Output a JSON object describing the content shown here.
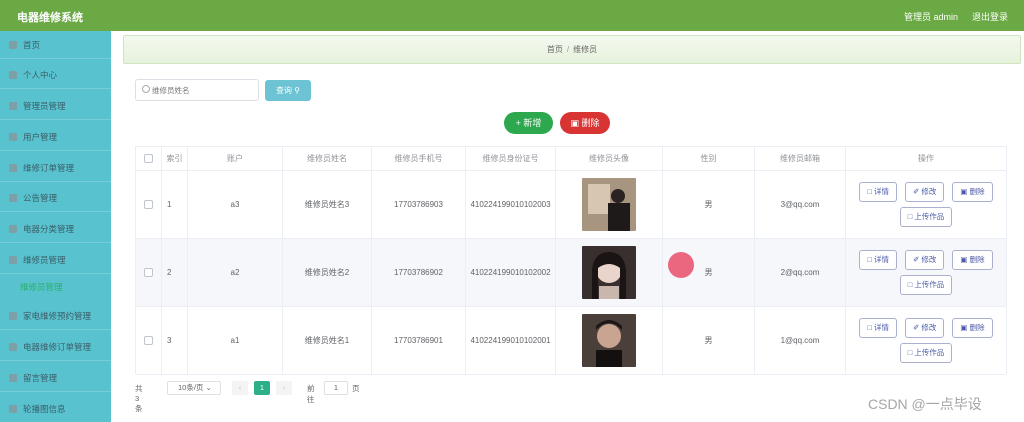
{
  "header": {
    "app_title": "电器维修系统",
    "admin_label": "管理员 admin",
    "logout_label": "退出登录",
    "bg_color": "#6aa944"
  },
  "sidebar": {
    "items": [
      {
        "label": "首页",
        "icon": "home-icon"
      },
      {
        "label": "个人中心",
        "icon": "user-icon"
      },
      {
        "label": "管理员管理",
        "icon": "admin-icon"
      },
      {
        "label": "用户管理",
        "icon": "users-icon"
      },
      {
        "label": "维修订单管理",
        "icon": "order-icon"
      },
      {
        "label": "公告管理",
        "icon": "notice-icon"
      },
      {
        "label": "电器分类管理",
        "icon": "category-icon"
      },
      {
        "label": "维修员管理",
        "icon": "worker-icon"
      },
      {
        "label": "家电维修预约管理",
        "icon": "appointment-icon"
      },
      {
        "label": "电器维修订单管理",
        "icon": "repair-order-icon"
      },
      {
        "label": "留言管理",
        "icon": "message-icon"
      },
      {
        "label": "轮播图信息",
        "icon": "carousel-icon"
      }
    ],
    "active_sub": "维修员管理",
    "bg_color": "#58c3cf"
  },
  "breadcrumb": {
    "home": "首页",
    "current": "维修员"
  },
  "toolbar": {
    "search_placeholder": "维修员姓名",
    "search_label": "查询",
    "add_label": "新增",
    "delete_label": "删除"
  },
  "table": {
    "columns": [
      "索引",
      "账户",
      "维修员姓名",
      "维修员手机号",
      "维修员身份证号",
      "维修员头像",
      "性别",
      "维修员邮箱",
      "操作"
    ],
    "rows": [
      {
        "index": "1",
        "account": "a3",
        "name": "维修员姓名3",
        "phone": "17703786903",
        "id_card": "410224199010102003",
        "gender": "男",
        "email": "3@qq.com",
        "avatar_color": "#8b7763"
      },
      {
        "index": "2",
        "account": "a2",
        "name": "维修员姓名2",
        "phone": "17703786902",
        "id_card": "410224199010102002",
        "gender": "男",
        "email": "2@qq.com",
        "avatar_color": "#4a3c3c"
      },
      {
        "index": "3",
        "account": "a1",
        "name": "维修员姓名1",
        "phone": "17703786901",
        "id_card": "410224199010102001",
        "gender": "男",
        "email": "1@qq.com",
        "avatar_color": "#5a4a44"
      }
    ],
    "actions": {
      "detail": "详情",
      "edit": "修改",
      "delete": "删除",
      "upload": "上传作品"
    }
  },
  "pagination": {
    "total": "共 3 条",
    "page_size": "10条/页",
    "current_page": "1",
    "goto_label": "前往",
    "goto_value": "1",
    "unit": "页"
  },
  "watermark": "CSDN @一点毕设"
}
